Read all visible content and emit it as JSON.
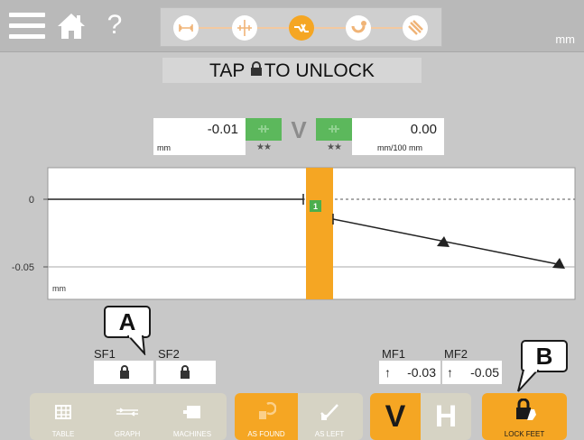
{
  "topbar": {
    "unit": "mm",
    "steps": [
      "dimensions-icon",
      "crosshair-icon",
      "measure-icon",
      "shim-icon",
      "results-icon"
    ]
  },
  "banner": {
    "before": "TAP",
    "after": "TO UNLOCK"
  },
  "readout": {
    "left_value": "-0.01",
    "left_unit": "mm",
    "left_stars": "★★",
    "mode_letter": "V",
    "right_stars": "★★",
    "right_value": "0.00",
    "right_unit": "mm/100 mm"
  },
  "chart_data": {
    "type": "line",
    "y_ticks": [
      "0",
      "-0.05"
    ],
    "y_unit": "mm",
    "marker_label": "1",
    "colors": {
      "highlight": "#f5a623",
      "marker": "#4cae4c",
      "line": "#222222"
    }
  },
  "feet": {
    "callout_a": "A",
    "callout_b": "B",
    "sf1_label": "SF1",
    "sf2_label": "SF2",
    "mf1_label": "MF1",
    "mf2_label": "MF2",
    "mf1_value": "-0.03",
    "mf2_value": "-0.05",
    "arrow": "↑"
  },
  "bottom": {
    "table": "TABLE",
    "graph": "GRAPH",
    "machines": "MACHINES",
    "as_found": "AS FOUND",
    "as_left": "AS LEFT",
    "v": "V",
    "h": "H",
    "lock_feet": "LOCK FEET"
  },
  "colors": {
    "accent": "#f5a623",
    "bar": "#c8c8c8",
    "green": "#5cb85c"
  }
}
